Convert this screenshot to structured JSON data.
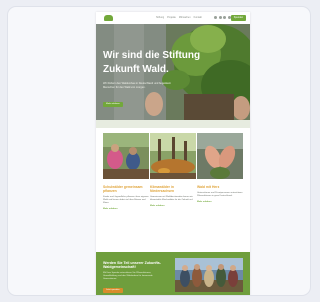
{
  "colors": {
    "brand_green": "#72a83a",
    "accent_orange": "#e0a53c",
    "cta_green": "#6f9e3d",
    "button_orange": "#d98c2b",
    "card_frame": "#f7f8fb"
  },
  "header": {
    "logo_icon": "leaf-logo-icon",
    "nav_links": [
      "Stiftung",
      "Projekte",
      "Mitmachen",
      "Kontakt"
    ],
    "icons": [
      "facebook-icon",
      "instagram-icon",
      "linkedin-icon",
      "search-icon"
    ],
    "donate_label": "Spenden"
  },
  "hero": {
    "title": "Wir sind die Stiftung Zukunft Wald.",
    "subtitle": "Wir fördern den Waldumbau in Deutschland und begeistern Menschen für den Wald von morgen.",
    "button_label": "Mehr erfahren"
  },
  "projects": [
    {
      "title": "Schulwälder gemeinsam pflanzen",
      "text": "Kinder und Jugendliche pflanzen ihren eigenen Wald und lernen dabei viel über Bäume und Klima.",
      "link": "Mehr erfahren"
    },
    {
      "title": "Klimawälder in Niedersachsen",
      "text": "Gemeinsam mit Waldbesitzenden bauen wir klimastabile Mischwälder für die Zukunft auf.",
      "link": "Mehr erfahren"
    },
    {
      "title": "Wald mit Herz",
      "text": "Unternehmen und Privatpersonen unterstützen Pflanzaktionen in ganz Deutschland.",
      "link": "Mehr erfahren"
    }
  ],
  "cta": {
    "title": "Werden Sie Teil unserer Zukunfts-Waldgemeinschaft!",
    "text": "Mit Ihrer Spende unterstützen Sie Pflanzaktionen, Umweltbildung und den Waldumbau für kommende Generationen.",
    "button_label": "Jetzt spenden"
  }
}
